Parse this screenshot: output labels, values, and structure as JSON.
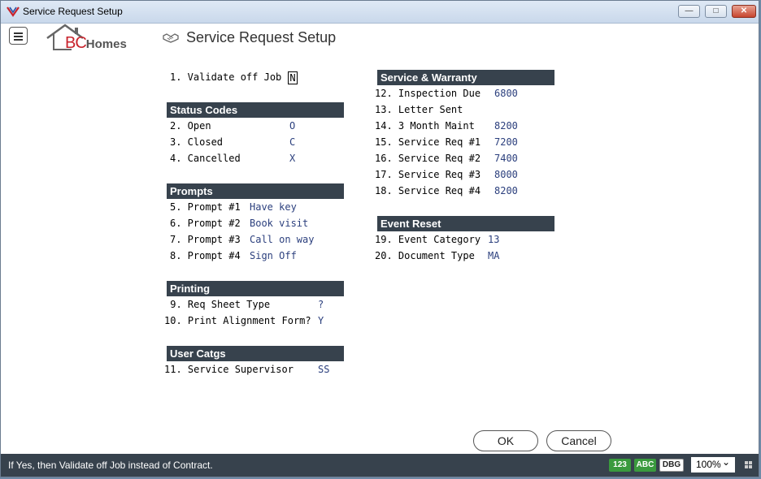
{
  "window": {
    "title": "Service Request Setup",
    "controls": {
      "minimize": "—",
      "maximize": "□",
      "close": "✕"
    }
  },
  "header": {
    "logo": {
      "brand": "BC",
      "suffix": "Homes"
    },
    "page_title": "Service Request Setup",
    "page_icon": "handshake-icon",
    "menu_icon": "hamburger-menu-icon"
  },
  "form": {
    "validate_off_job": {
      "label": "1. Validate off Job",
      "value": "N"
    },
    "status_codes": {
      "heading": "Status Codes",
      "rows": [
        {
          "label": "2. Open",
          "value": "O"
        },
        {
          "label": "3. Closed",
          "value": "C"
        },
        {
          "label": "4. Cancelled",
          "value": "X"
        }
      ]
    },
    "prompts": {
      "heading": "Prompts",
      "rows": [
        {
          "label": "5. Prompt #1",
          "value": "Have key"
        },
        {
          "label": "6. Prompt #2",
          "value": "Book visit"
        },
        {
          "label": "7. Prompt #3",
          "value": "Call on way"
        },
        {
          "label": "8. Prompt #4",
          "value": "Sign Off"
        }
      ]
    },
    "printing": {
      "heading": "Printing",
      "rows": [
        {
          "label": " 9. Req Sheet Type",
          "value": "?"
        },
        {
          "label": "10. Print Alignment Form?",
          "value": "Y"
        }
      ]
    },
    "user_catgs": {
      "heading": "User Catgs",
      "rows": [
        {
          "label": "11. Service Supervisor",
          "value": "SS"
        }
      ]
    },
    "service_warranty": {
      "heading": "Service & Warranty",
      "rows": [
        {
          "label": "12. Inspection Due",
          "value": "6800"
        },
        {
          "label": "13. Letter Sent",
          "value": ""
        },
        {
          "label": "14. 3 Month Maint",
          "value": "8200"
        },
        {
          "label": "15. Service Req #1",
          "value": "7200"
        },
        {
          "label": "16. Service Req #2",
          "value": "7400"
        },
        {
          "label": "17. Service Req #3",
          "value": "8000"
        },
        {
          "label": "18. Service Req #4",
          "value": "8200"
        }
      ]
    },
    "event_reset": {
      "heading": "Event Reset",
      "rows": [
        {
          "label": "19. Event Category",
          "value": "13"
        },
        {
          "label": "20. Document Type",
          "value": "MA"
        }
      ]
    }
  },
  "buttons": {
    "ok": "OK",
    "cancel": "Cancel"
  },
  "status": {
    "message": "If Yes, then Validate off Job instead of Contract.",
    "indicators": [
      "123",
      "ABC",
      "DBG"
    ],
    "zoom": "100%",
    "zoom_chevron": "⌄"
  },
  "colors": {
    "section_bg": "#37424d",
    "value_text": "#2b3f7d",
    "indicator_green": "#3a9a3e",
    "brand_red": "#c8232c"
  }
}
